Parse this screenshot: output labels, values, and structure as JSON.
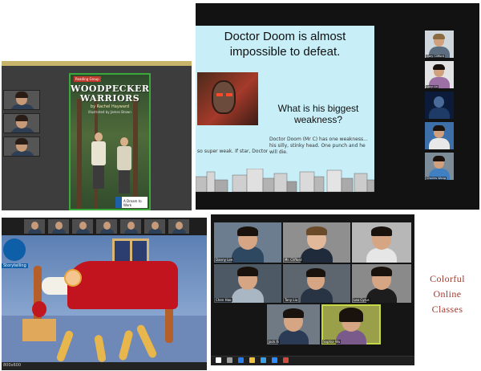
{
  "book_panel": {
    "book": {
      "publisher": "Reading Group",
      "title_line1": "WOODPECKER",
      "title_line2": "WARRIORS",
      "author": "by Rachel Hayward",
      "illustrator": "Illustrated by James Brown",
      "badge": "A Dream to Work"
    }
  },
  "slide_panel": {
    "slide": {
      "headline": "Doctor Doom is almost impossible to defeat.",
      "question": "What is his biggest weakness?",
      "answer": "Doctor Doom (Mr C) has one weakness... his silly, stinky head. One punch and he will die.",
      "answer_left": "so super weak. If star, Doctor Doom"
    },
    "participants": [
      {
        "name": "Gary Clifford"
      },
      {
        "name": "Lucy Lin"
      },
      {
        "name": ""
      },
      {
        "name": ""
      },
      {
        "name": "Charles Wang"
      }
    ]
  },
  "cartoon_panel": {
    "logo_text": "Storytelling",
    "taskbar_text": "800x600"
  },
  "gallery_panel": {
    "participants": [
      {
        "name": "Danny Lee"
      },
      {
        "name": "Mr. Clifford"
      },
      {
        "name": ""
      },
      {
        "name": "Chen Hao"
      },
      {
        "name": "Tony Liu"
      },
      {
        "name": "Leo Cyrus"
      },
      {
        "name": "Jack Xi"
      },
      {
        "name": "Sophia Wu"
      }
    ]
  },
  "caption": {
    "line1": "Colorful",
    "line2": "Online",
    "line3": "Classes"
  },
  "colors": {
    "caption": "#a3382d",
    "slide_bg": "#c8eef8",
    "active_speaker": "#c6d845",
    "book_border": "#3aa83a"
  }
}
